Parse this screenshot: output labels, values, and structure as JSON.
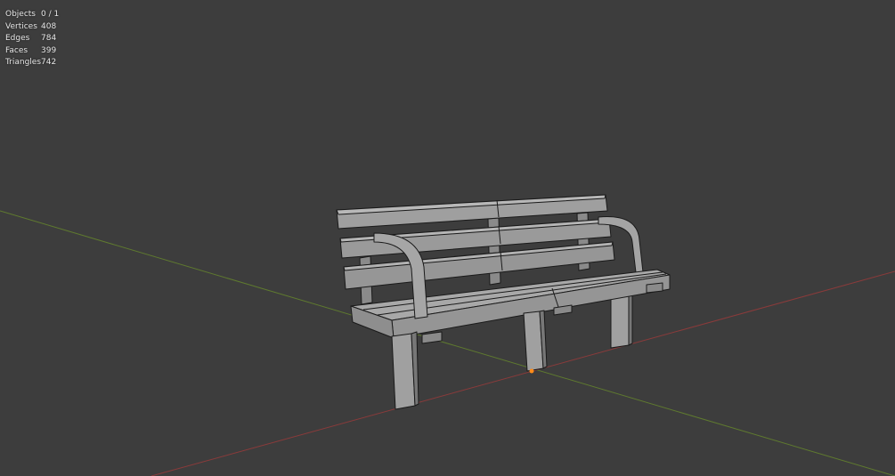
{
  "app": {
    "colors": {
      "viewport_bg": "#3d3d3d",
      "x_axis": "#8a3b3b",
      "y_axis": "#5f7a2f",
      "origin": "#ff8c1a",
      "mesh_face": "#9b9b9b",
      "mesh_edge": "#1a1a1a"
    }
  },
  "stats": {
    "rows": [
      {
        "label": "Objects",
        "value": "0 / 1"
      },
      {
        "label": "Vertices",
        "value": "408"
      },
      {
        "label": "Edges",
        "value": "784"
      },
      {
        "label": "Faces",
        "value": "399"
      },
      {
        "label": "Triangles",
        "value": "742"
      }
    ]
  },
  "scene": {
    "object": "bench-mesh",
    "origin_icon": "origin-dot-icon"
  }
}
